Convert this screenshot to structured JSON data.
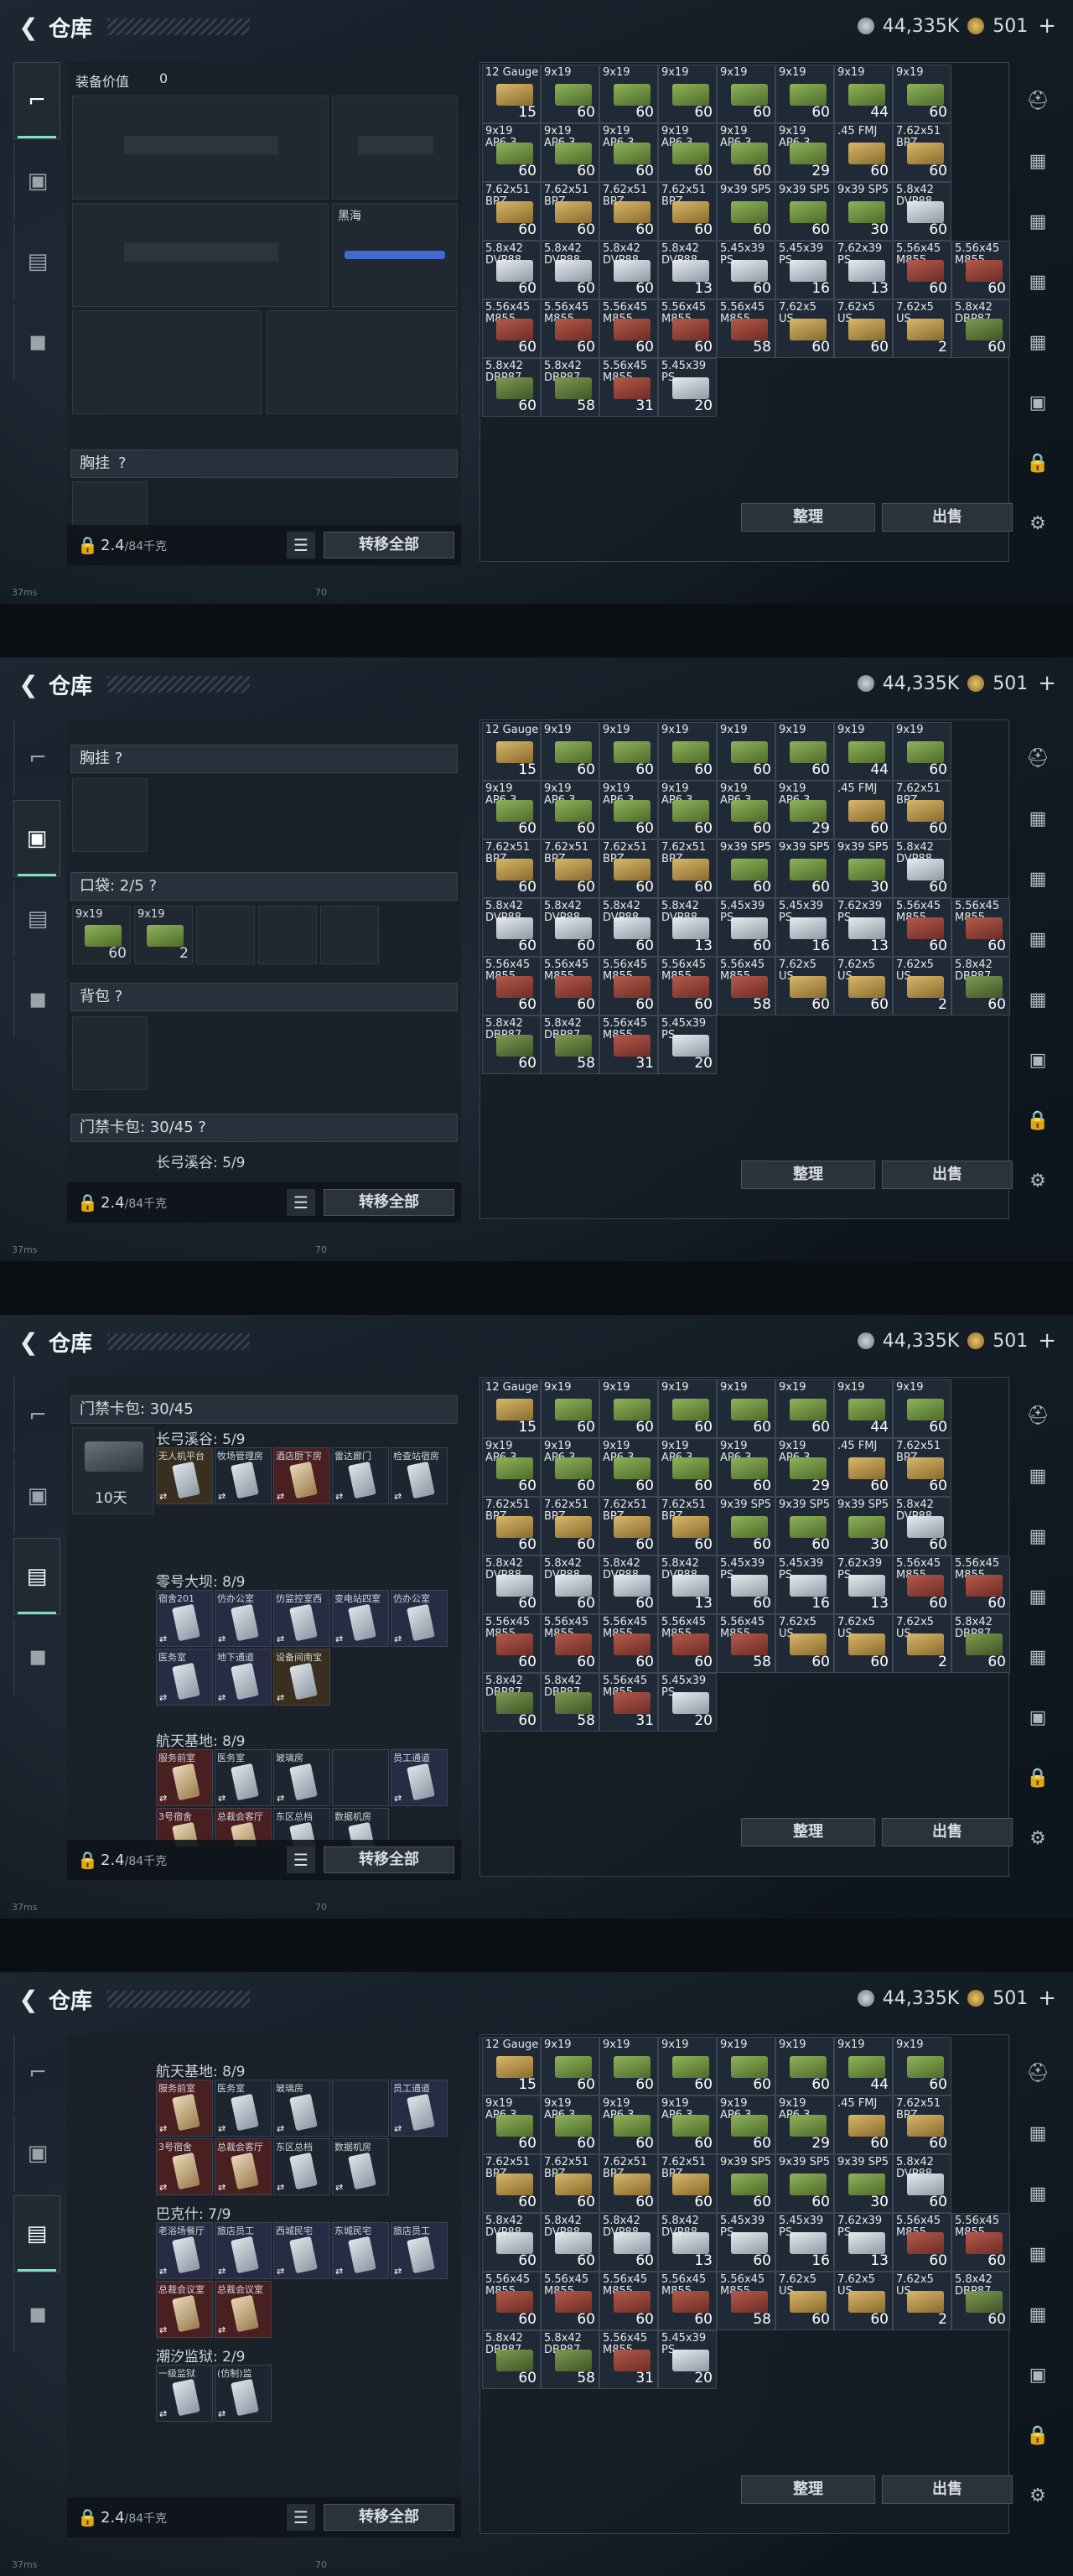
{
  "header": {
    "title": "仓库",
    "silver": "44,335K",
    "gold": "501",
    "gold_plus": "+"
  },
  "frame1": {
    "equip_value_label": "装备价值",
    "equip_value": "0",
    "slot_label": "黑海",
    "section_chest": "胸挂",
    "section_help": "?",
    "weight": "2.4",
    "weight_unit": "/84千克",
    "transfer": "转移全部"
  },
  "frame2": {
    "section_chest": "胸挂 ?",
    "section_pocket": "口袋: 2/5 ?",
    "section_backpack": "背包 ?",
    "section_keycard": "门禁卡包: 30/45 ?",
    "sub_changgong": "长弓溪谷: 5/9",
    "pocket_items": [
      {
        "label": "9x19",
        "qty": "60"
      },
      {
        "label": "9x19",
        "qty": "2"
      }
    ]
  },
  "frame3": {
    "section_keycard": "门禁卡包: 30/45",
    "days": "10天",
    "cat1": "长弓溪谷: 5/9",
    "cat2": "零号大坝: 8/9",
    "cat3": "航天基地: 8/9",
    "cards1": [
      "无人机平台",
      "牧场管理房",
      "酒店厨下房",
      "雷达廊门",
      "检查站宿房"
    ],
    "cards2": [
      "宿舍201",
      "仿办公室",
      "仿监控室西",
      "变电站四室",
      "仿办公室",
      "医务室",
      "地下通道",
      "设备间南宝"
    ],
    "cards3": [
      "服务前室",
      "医务室",
      "玻璃房",
      "",
      "员工通道",
      "3号宿舍",
      "总裁会客厅",
      "东区总档",
      "数据机房"
    ]
  },
  "frame4": {
    "cat3": "航天基地: 8/9",
    "cat4": "巴克什: 7/9",
    "cat5": "潮汐监狱: 2/9",
    "cards3": [
      "服务前室",
      "医务室",
      "玻璃房",
      "",
      "员工通道",
      "3号宿舍",
      "总裁会客厅",
      "东区总档",
      "数据机房"
    ],
    "cards4": [
      "老浴场餐厅",
      "旅店员工",
      "西城民宅",
      "东城民宅",
      "旅店员工",
      "总裁会议室",
      "总裁会议室"
    ],
    "cards5": [
      "一级监狱",
      "(仿制)监"
    ]
  },
  "buttons": {
    "sort": "整理",
    "sell": "出售"
  },
  "status": {
    "ping": "37ms",
    "fps": "70"
  },
  "ammo_grid": [
    [
      {
        "l": "12 Gauge",
        "q": "15",
        "c": "tan"
      },
      {
        "l": "9x19",
        "q": "60",
        "c": "green"
      },
      {
        "l": "9x19",
        "q": "60",
        "c": "green"
      },
      {
        "l": "9x19",
        "q": "60",
        "c": "green"
      },
      {
        "l": "9x19",
        "q": "60",
        "c": "green"
      },
      {
        "l": "9x19",
        "q": "60",
        "c": "green"
      },
      {
        "l": "9x19",
        "q": "44",
        "c": "green"
      },
      {
        "l": "9x19",
        "q": "60",
        "c": "green"
      }
    ],
    [
      {
        "l": "9x19 AP6.3",
        "q": "60",
        "c": "green"
      },
      {
        "l": "9x19 AP6.3",
        "q": "60",
        "c": "green"
      },
      {
        "l": "9x19 AP6.3",
        "q": "60",
        "c": "green"
      },
      {
        "l": "9x19 AP6.3",
        "q": "60",
        "c": "green"
      },
      {
        "l": "9x19 AP6.3",
        "q": "60",
        "c": "green"
      },
      {
        "l": "9x19 AP6.3",
        "q": "29",
        "c": "green"
      },
      {
        "l": ".45 FMJ",
        "q": "60",
        "c": "tan"
      },
      {
        "l": "7.62x51 BPZ",
        "q": "60",
        "c": "tan"
      }
    ],
    [
      {
        "l": "7.62x51 BPZ",
        "q": "60",
        "c": "tan"
      },
      {
        "l": "7.62x51 BPZ",
        "q": "60",
        "c": "tan"
      },
      {
        "l": "7.62x51 BPZ",
        "q": "60",
        "c": "tan"
      },
      {
        "l": "7.62x51 BPZ",
        "q": "60",
        "c": "tan"
      },
      {
        "l": "9x39 SP5",
        "q": "60",
        "c": "green"
      },
      {
        "l": "9x39 SP5",
        "q": "60",
        "c": "green"
      },
      {
        "l": "9x39 SP5",
        "q": "30",
        "c": "green"
      },
      {
        "l": "5.8x42 DVP88",
        "q": "60",
        "c": "white"
      }
    ],
    [
      {
        "l": "5.8x42 DVP88",
        "q": "60",
        "c": "white"
      },
      {
        "l": "5.8x42 DVP88",
        "q": "60",
        "c": "white"
      },
      {
        "l": "5.8x42 DVP88",
        "q": "60",
        "c": "white"
      },
      {
        "l": "5.8x42 DVP88",
        "q": "13",
        "c": "white"
      },
      {
        "l": "5.45x39 PS",
        "q": "60",
        "c": "white"
      },
      {
        "l": "5.45x39 PS",
        "q": "16",
        "c": "white"
      },
      {
        "l": "7.62x39 PS",
        "q": "13",
        "c": "white"
      },
      {
        "l": "5.56x45 M855",
        "q": "60",
        "c": "red"
      },
      {
        "l": "5.56x45 M855",
        "q": "60",
        "c": "red"
      }
    ],
    [
      {
        "l": "5.56x45 M855",
        "q": "60",
        "c": "red"
      },
      {
        "l": "5.56x45 M855",
        "q": "60",
        "c": "red"
      },
      {
        "l": "5.56x45 M855",
        "q": "60",
        "c": "red"
      },
      {
        "l": "5.56x45 M855",
        "q": "60",
        "c": "red"
      },
      {
        "l": "5.56x45 M855",
        "q": "58",
        "c": "red"
      },
      {
        "l": "7.62x5 US",
        "q": "60",
        "c": "tan"
      },
      {
        "l": "7.62x5 US",
        "q": "60",
        "c": "tan"
      },
      {
        "l": "7.62x5 US",
        "q": "2",
        "c": "tan"
      },
      {
        "l": "5.8x42 DBP87",
        "q": "60",
        "c": "olive"
      }
    ],
    [
      {
        "l": "5.8x42 DBP87",
        "q": "60",
        "c": "olive"
      },
      {
        "l": "5.8x42 DBP87",
        "q": "58",
        "c": "olive"
      },
      {
        "l": "5.56x45 M855",
        "q": "31",
        "c": "red"
      },
      {
        "l": "5.45x39 PS",
        "q": "20",
        "c": "white"
      }
    ]
  ]
}
